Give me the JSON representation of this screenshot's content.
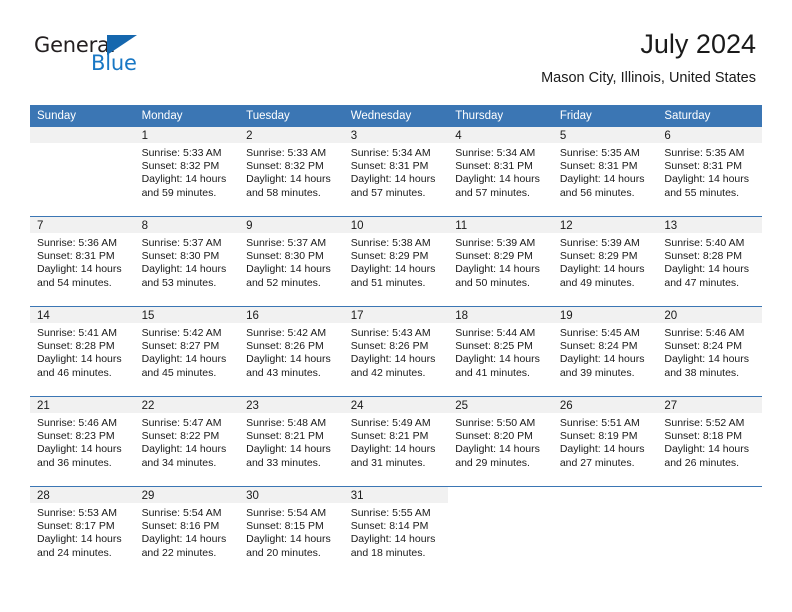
{
  "brand": {
    "name_top": "General",
    "name_bottom": "Blue",
    "triangle_icon": "triangle-icon",
    "color_dark": "#231f20",
    "color_blue": "#1877c4"
  },
  "header": {
    "title": "July 2024",
    "subtitle": "Mason City, Illinois, United States"
  },
  "theme": {
    "header_blue": "#3b76b4",
    "daynum_band": "#f1f1f1",
    "text": "#1a1a1a"
  },
  "calendar": {
    "weekday_headers": [
      "Sunday",
      "Monday",
      "Tuesday",
      "Wednesday",
      "Thursday",
      "Friday",
      "Saturday"
    ],
    "weeks": [
      [
        {
          "day": "",
          "lines": []
        },
        {
          "day": "1",
          "lines": [
            "Sunrise: 5:33 AM",
            "Sunset: 8:32 PM",
            "Daylight: 14 hours",
            "and 59 minutes."
          ]
        },
        {
          "day": "2",
          "lines": [
            "Sunrise: 5:33 AM",
            "Sunset: 8:32 PM",
            "Daylight: 14 hours",
            "and 58 minutes."
          ]
        },
        {
          "day": "3",
          "lines": [
            "Sunrise: 5:34 AM",
            "Sunset: 8:31 PM",
            "Daylight: 14 hours",
            "and 57 minutes."
          ]
        },
        {
          "day": "4",
          "lines": [
            "Sunrise: 5:34 AM",
            "Sunset: 8:31 PM",
            "Daylight: 14 hours",
            "and 57 minutes."
          ]
        },
        {
          "day": "5",
          "lines": [
            "Sunrise: 5:35 AM",
            "Sunset: 8:31 PM",
            "Daylight: 14 hours",
            "and 56 minutes."
          ]
        },
        {
          "day": "6",
          "lines": [
            "Sunrise: 5:35 AM",
            "Sunset: 8:31 PM",
            "Daylight: 14 hours",
            "and 55 minutes."
          ]
        }
      ],
      [
        {
          "day": "7",
          "lines": [
            "Sunrise: 5:36 AM",
            "Sunset: 8:31 PM",
            "Daylight: 14 hours",
            "and 54 minutes."
          ]
        },
        {
          "day": "8",
          "lines": [
            "Sunrise: 5:37 AM",
            "Sunset: 8:30 PM",
            "Daylight: 14 hours",
            "and 53 minutes."
          ]
        },
        {
          "day": "9",
          "lines": [
            "Sunrise: 5:37 AM",
            "Sunset: 8:30 PM",
            "Daylight: 14 hours",
            "and 52 minutes."
          ]
        },
        {
          "day": "10",
          "lines": [
            "Sunrise: 5:38 AM",
            "Sunset: 8:29 PM",
            "Daylight: 14 hours",
            "and 51 minutes."
          ]
        },
        {
          "day": "11",
          "lines": [
            "Sunrise: 5:39 AM",
            "Sunset: 8:29 PM",
            "Daylight: 14 hours",
            "and 50 minutes."
          ]
        },
        {
          "day": "12",
          "lines": [
            "Sunrise: 5:39 AM",
            "Sunset: 8:29 PM",
            "Daylight: 14 hours",
            "and 49 minutes."
          ]
        },
        {
          "day": "13",
          "lines": [
            "Sunrise: 5:40 AM",
            "Sunset: 8:28 PM",
            "Daylight: 14 hours",
            "and 47 minutes."
          ]
        }
      ],
      [
        {
          "day": "14",
          "lines": [
            "Sunrise: 5:41 AM",
            "Sunset: 8:28 PM",
            "Daylight: 14 hours",
            "and 46 minutes."
          ]
        },
        {
          "day": "15",
          "lines": [
            "Sunrise: 5:42 AM",
            "Sunset: 8:27 PM",
            "Daylight: 14 hours",
            "and 45 minutes."
          ]
        },
        {
          "day": "16",
          "lines": [
            "Sunrise: 5:42 AM",
            "Sunset: 8:26 PM",
            "Daylight: 14 hours",
            "and 43 minutes."
          ]
        },
        {
          "day": "17",
          "lines": [
            "Sunrise: 5:43 AM",
            "Sunset: 8:26 PM",
            "Daylight: 14 hours",
            "and 42 minutes."
          ]
        },
        {
          "day": "18",
          "lines": [
            "Sunrise: 5:44 AM",
            "Sunset: 8:25 PM",
            "Daylight: 14 hours",
            "and 41 minutes."
          ]
        },
        {
          "day": "19",
          "lines": [
            "Sunrise: 5:45 AM",
            "Sunset: 8:24 PM",
            "Daylight: 14 hours",
            "and 39 minutes."
          ]
        },
        {
          "day": "20",
          "lines": [
            "Sunrise: 5:46 AM",
            "Sunset: 8:24 PM",
            "Daylight: 14 hours",
            "and 38 minutes."
          ]
        }
      ],
      [
        {
          "day": "21",
          "lines": [
            "Sunrise: 5:46 AM",
            "Sunset: 8:23 PM",
            "Daylight: 14 hours",
            "and 36 minutes."
          ]
        },
        {
          "day": "22",
          "lines": [
            "Sunrise: 5:47 AM",
            "Sunset: 8:22 PM",
            "Daylight: 14 hours",
            "and 34 minutes."
          ]
        },
        {
          "day": "23",
          "lines": [
            "Sunrise: 5:48 AM",
            "Sunset: 8:21 PM",
            "Daylight: 14 hours",
            "and 33 minutes."
          ]
        },
        {
          "day": "24",
          "lines": [
            "Sunrise: 5:49 AM",
            "Sunset: 8:21 PM",
            "Daylight: 14 hours",
            "and 31 minutes."
          ]
        },
        {
          "day": "25",
          "lines": [
            "Sunrise: 5:50 AM",
            "Sunset: 8:20 PM",
            "Daylight: 14 hours",
            "and 29 minutes."
          ]
        },
        {
          "day": "26",
          "lines": [
            "Sunrise: 5:51 AM",
            "Sunset: 8:19 PM",
            "Daylight: 14 hours",
            "and 27 minutes."
          ]
        },
        {
          "day": "27",
          "lines": [
            "Sunrise: 5:52 AM",
            "Sunset: 8:18 PM",
            "Daylight: 14 hours",
            "and 26 minutes."
          ]
        }
      ],
      [
        {
          "day": "28",
          "lines": [
            "Sunrise: 5:53 AM",
            "Sunset: 8:17 PM",
            "Daylight: 14 hours",
            "and 24 minutes."
          ]
        },
        {
          "day": "29",
          "lines": [
            "Sunrise: 5:54 AM",
            "Sunset: 8:16 PM",
            "Daylight: 14 hours",
            "and 22 minutes."
          ]
        },
        {
          "day": "30",
          "lines": [
            "Sunrise: 5:54 AM",
            "Sunset: 8:15 PM",
            "Daylight: 14 hours",
            "and 20 minutes."
          ]
        },
        {
          "day": "31",
          "lines": [
            "Sunrise: 5:55 AM",
            "Sunset: 8:14 PM",
            "Daylight: 14 hours",
            "and 18 minutes."
          ]
        },
        {
          "day": "",
          "lines": []
        },
        {
          "day": "",
          "lines": []
        },
        {
          "day": "",
          "lines": []
        }
      ]
    ]
  }
}
